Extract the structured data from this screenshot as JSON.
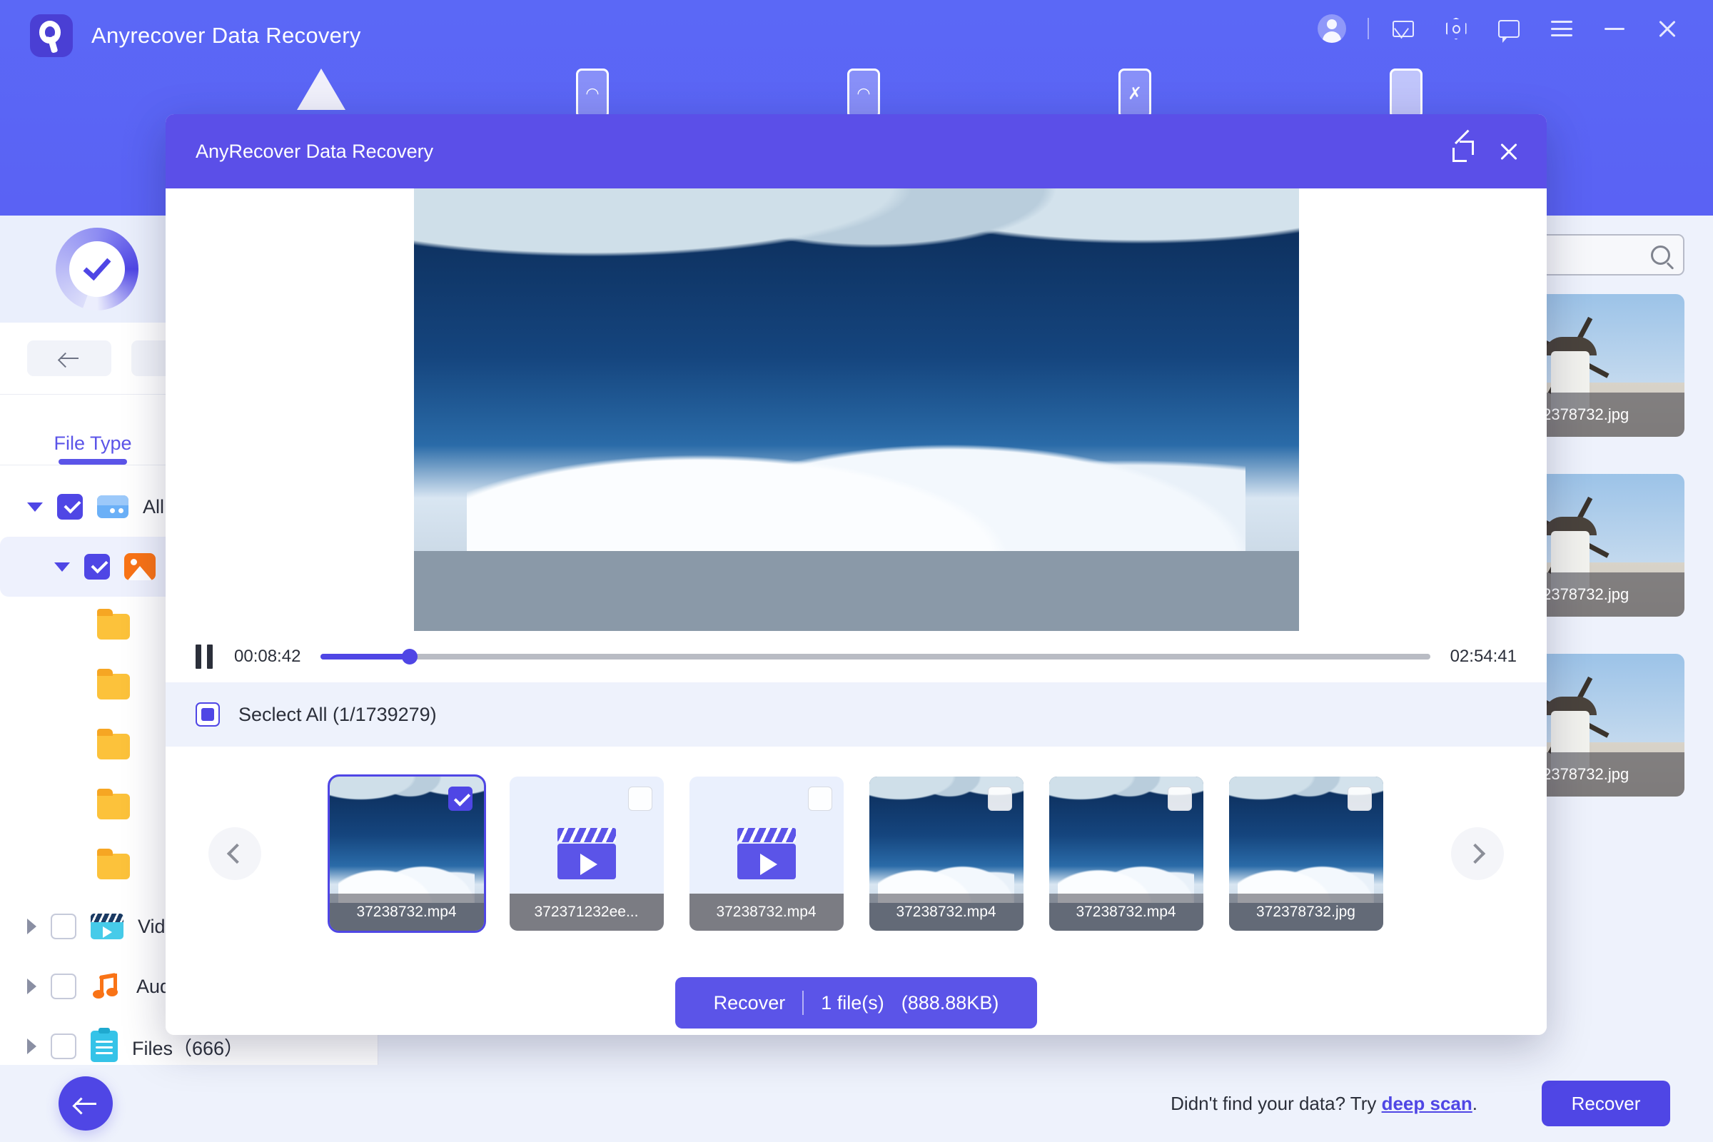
{
  "app": {
    "title": "Anyrecover Data Recovery",
    "header_icons": [
      "avatar-icon",
      "mail-icon",
      "hexagon-icon",
      "chat-icon",
      "menu-icon",
      "minimize-icon",
      "close-icon"
    ]
  },
  "sidebar": {
    "tab_label": "File Type",
    "tree": [
      {
        "label": "All",
        "icon": "drive-icon",
        "checked": true,
        "expanded": true,
        "indent": 0
      },
      {
        "label": "",
        "icon": "photo-icon",
        "checked": true,
        "expanded": true,
        "indent": 1,
        "selected": true
      },
      {
        "label": "",
        "icon": "folder-icon",
        "checked": false,
        "indent": 2
      },
      {
        "label": "",
        "icon": "folder-icon",
        "checked": false,
        "indent": 2
      },
      {
        "label": "",
        "icon": "folder-icon",
        "checked": false,
        "indent": 2
      },
      {
        "label": "",
        "icon": "folder-icon",
        "checked": false,
        "indent": 2
      },
      {
        "label": "",
        "icon": "folder-icon",
        "checked": false,
        "indent": 2
      },
      {
        "label": "Video",
        "icon": "video-icon",
        "checked": false,
        "indent": 0
      },
      {
        "label": "Audio",
        "icon": "audio-icon",
        "checked": false,
        "indent": 0
      },
      {
        "label": "Files（666）",
        "icon": "document-icon",
        "checked": false,
        "indent": 0
      }
    ]
  },
  "search": {
    "value": "",
    "placeholder": ""
  },
  "file_grid": [
    {
      "name": "2378732.jpg",
      "kind": "image"
    },
    {
      "name": "2378732.jpg",
      "kind": "image"
    },
    {
      "name": "2378732.jpg",
      "kind": "image"
    }
  ],
  "bottom": {
    "deep_scan_prefix": "Didn't find your data? Try ",
    "deep_scan_link": "deep scan",
    "deep_scan_suffix": ".",
    "recover_label": "Recover"
  },
  "modal": {
    "title": "AnyRecover Data Recovery",
    "player": {
      "state": "paused",
      "current_time": "00:08:42",
      "total_time": "02:54:41",
      "progress_percent": 8
    },
    "select_all_label": "Seclect All (1/1739279)",
    "select_all_state": "indeterminate",
    "carousel": {
      "prev_label": "Previous",
      "next_label": "Next"
    },
    "thumbnails": [
      {
        "name": "37238732.mp4",
        "kind": "video-preview",
        "checked": true,
        "active": true
      },
      {
        "name": "372371232ee...",
        "kind": "video-icon",
        "checked": false,
        "active": false
      },
      {
        "name": "37238732.mp4",
        "kind": "video-icon",
        "checked": false,
        "active": false
      },
      {
        "name": "37238732.mp4",
        "kind": "video-preview",
        "checked": false,
        "active": false
      },
      {
        "name": "37238732.mp4",
        "kind": "video-preview",
        "checked": false,
        "active": false
      },
      {
        "name": "372378732.jpg",
        "kind": "video-preview",
        "checked": false,
        "active": false
      }
    ],
    "recover_button": {
      "label": "Recover",
      "count_label": "1 file(s)",
      "size_label": "(888.88KB)"
    }
  },
  "colors": {
    "brand_purple": "#5b68f6",
    "modal_purple": "#5b4fe8",
    "accent": "#4f46e5",
    "page_bg": "#eef2fc"
  }
}
